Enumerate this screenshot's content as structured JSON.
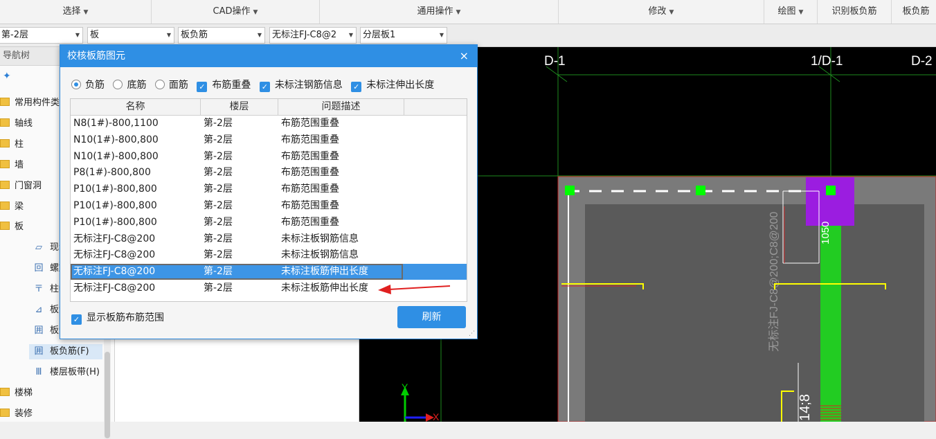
{
  "ribbon": {
    "groups": [
      {
        "label": "选择",
        "caret": "▼"
      },
      {
        "label": "CAD操作",
        "caret": "▼"
      },
      {
        "label": "通用操作",
        "caret": "▼"
      },
      {
        "label": "修改",
        "caret": "▼"
      },
      {
        "label": "绘图",
        "caret": "▼"
      },
      {
        "label": "识别板负筋",
        "caret": ""
      },
      {
        "label": "板负筋",
        "caret": ""
      }
    ]
  },
  "toolbar": {
    "floor": "第-2层",
    "category": "板",
    "type": "板负筋",
    "element": "无标注FJ-C8@2",
    "layer": "分层板1"
  },
  "nav": {
    "header": "导航树",
    "add_icon": "✦",
    "items": [
      {
        "label": "常用构件类",
        "kind": "folder"
      },
      {
        "label": "轴线",
        "kind": "folder"
      },
      {
        "label": "柱",
        "kind": "folder"
      },
      {
        "label": "墙",
        "kind": "folder"
      },
      {
        "label": "门窗洞",
        "kind": "folder"
      },
      {
        "label": "梁",
        "kind": "folder"
      },
      {
        "label": "板",
        "kind": "folder-open"
      },
      {
        "label": "现浇板",
        "kind": "sub",
        "icon": "▱"
      },
      {
        "label": "螺旋板",
        "kind": "sub",
        "icon": "回"
      },
      {
        "label": "柱帽",
        "kind": "sub",
        "icon": "〒"
      },
      {
        "label": "板洞",
        "kind": "sub",
        "icon": "⊿"
      },
      {
        "label": "板受力筋",
        "kind": "sub",
        "icon": "囲"
      },
      {
        "label": "板负筋(F)",
        "kind": "sub-selected",
        "icon": "囲"
      },
      {
        "label": "楼层板带(H)",
        "kind": "sub",
        "icon": "Ⅲ"
      },
      {
        "label": "楼梯",
        "kind": "folder"
      },
      {
        "label": "装修",
        "kind": "folder"
      }
    ]
  },
  "dialog": {
    "title": "校核板筋图元",
    "close": "×",
    "radios": [
      {
        "label": "负筋",
        "checked": true
      },
      {
        "label": "底筋",
        "checked": false
      },
      {
        "label": "面筋",
        "checked": false
      }
    ],
    "checks": [
      {
        "label": "布筋重叠",
        "checked": true
      },
      {
        "label": "未标注钢筋信息",
        "checked": true
      },
      {
        "label": "未标注伸出长度",
        "checked": true
      }
    ],
    "columns": [
      "名称",
      "楼层",
      "问题描述"
    ],
    "rows": [
      {
        "name": "N8(1#)-800,1100",
        "floor": "第-2层",
        "issue": "布筋范围重叠"
      },
      {
        "name": "N10(1#)-800,800",
        "floor": "第-2层",
        "issue": "布筋范围重叠"
      },
      {
        "name": "N10(1#)-800,800",
        "floor": "第-2层",
        "issue": "布筋范围重叠"
      },
      {
        "name": "P8(1#)-800,800",
        "floor": "第-2层",
        "issue": "布筋范围重叠"
      },
      {
        "name": "P10(1#)-800,800",
        "floor": "第-2层",
        "issue": "布筋范围重叠"
      },
      {
        "name": "P10(1#)-800,800",
        "floor": "第-2层",
        "issue": "布筋范围重叠"
      },
      {
        "name": "P10(1#)-800,800",
        "floor": "第-2层",
        "issue": "布筋范围重叠"
      },
      {
        "name": "无标注FJ-C8@200",
        "floor": "第-2层",
        "issue": "未标注板钢筋信息"
      },
      {
        "name": "无标注FJ-C8@200",
        "floor": "第-2层",
        "issue": "未标注板钢筋信息"
      },
      {
        "name": "无标注FJ-C8@200",
        "floor": "第-2层",
        "issue": "未标注板筋伸出长度",
        "selected": true
      },
      {
        "name": "无标注FJ-C8@200",
        "floor": "第-2层",
        "issue": "未标注板筋伸出长度"
      }
    ],
    "show_range_label": "显示板筋布筋范围",
    "refresh_label": "刷新"
  },
  "cad": {
    "axis_labels": [
      "D-1",
      "1/D-1",
      "D-2"
    ],
    "rebar_text": "无标注FJ-C8@200;C8@200",
    "dim_1050": "1050",
    "dim_14_8": "14;8",
    "axis_y": "Y",
    "axis_x": "X"
  },
  "colors": {
    "accent": "#2f8fe4",
    "cad_bg": "#000000",
    "slab": "#5a5a5a",
    "rebar_green": "#22cc22",
    "purple": "#a020f0",
    "yellow": "#ffff00",
    "annotation_red": "#e02020"
  }
}
